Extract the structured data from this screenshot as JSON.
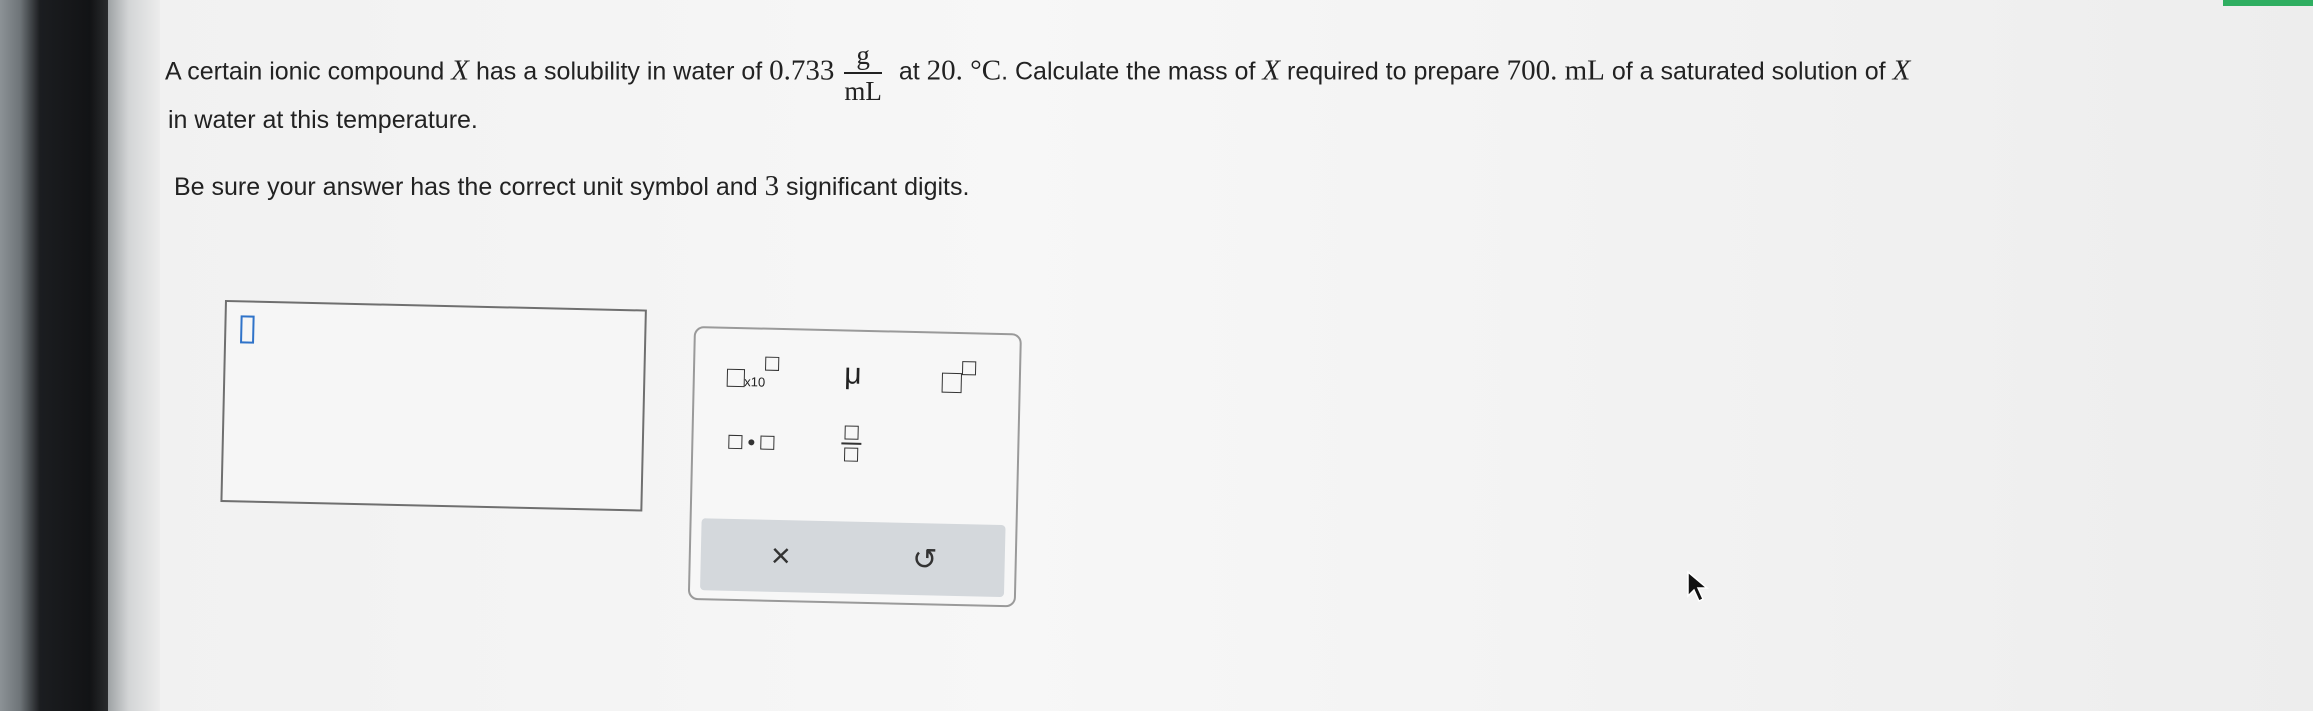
{
  "question": {
    "text1": "A certain ionic compound ",
    "var_x": "X",
    "text2": " has a solubility in water of ",
    "solubility": "0.733",
    "unit_num": "g",
    "unit_den": "mL",
    "text3": " at ",
    "temp": "20. °C",
    "text4": ". Calculate the mass of ",
    "text5": " required to prepare ",
    "volume": "700. mL",
    "text6": " of a saturated solution of ",
    "trailing": "X",
    "line2": "in water at this temperature."
  },
  "instruction": {
    "text1": "Be sure your answer has the correct unit symbol and ",
    "digits": "3",
    "text2": " significant digits."
  },
  "answer": {
    "value": ""
  },
  "tools": {
    "sci_notation_label": "x10",
    "mu_label": "μ",
    "clear_label": "×",
    "undo_label": "↺"
  },
  "colors": {
    "accent": "#2f73c9",
    "green_bar": "#2fae61"
  }
}
